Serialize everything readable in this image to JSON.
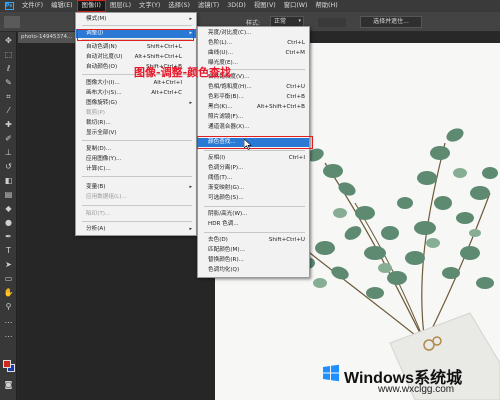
{
  "menubar": {
    "logo": "Ps",
    "items": [
      "文件(F)",
      "编辑(E)",
      "图像(I)",
      "图层(L)",
      "文字(Y)",
      "选择(S)",
      "滤镜(T)",
      "3D(D)",
      "视图(V)",
      "窗口(W)",
      "帮助(H)"
    ]
  },
  "options_bar": {
    "style_label": "样式:",
    "style_value": "正常",
    "select_mask_button": "选择并遮住..."
  },
  "document": {
    "tab_title": "photo-14945374..."
  },
  "image_menu": {
    "items": [
      {
        "label": "模式(M)",
        "shortcut": "",
        "submenu": true,
        "disabled": false
      },
      {
        "label": "调整(J)",
        "shortcut": "",
        "submenu": true,
        "disabled": false,
        "highlighted": true
      },
      {
        "label": "自动色调(N)",
        "shortcut": "Shift+Ctrl+L",
        "submenu": false,
        "disabled": false
      },
      {
        "label": "自动对比度(U)",
        "shortcut": "Alt+Shift+Ctrl+L",
        "submenu": false,
        "disabled": false
      },
      {
        "label": "自动颜色(O)",
        "shortcut": "Shift+Ctrl+B",
        "submenu": false,
        "disabled": false
      },
      {
        "label": "图像大小(I)...",
        "shortcut": "Alt+Ctrl+I",
        "submenu": false,
        "disabled": false
      },
      {
        "label": "画布大小(S)...",
        "shortcut": "Alt+Ctrl+C",
        "submenu": false,
        "disabled": false
      },
      {
        "label": "图像旋转(G)",
        "shortcut": "",
        "submenu": true,
        "disabled": false
      },
      {
        "label": "裁剪(P)",
        "shortcut": "",
        "submenu": false,
        "disabled": true
      },
      {
        "label": "裁切(R)...",
        "shortcut": "",
        "submenu": false,
        "disabled": false
      },
      {
        "label": "显示全部(V)",
        "shortcut": "",
        "submenu": false,
        "disabled": false
      },
      {
        "label": "复制(D)...",
        "shortcut": "",
        "submenu": false,
        "disabled": false
      },
      {
        "label": "应用图像(Y)...",
        "shortcut": "",
        "submenu": false,
        "disabled": false
      },
      {
        "label": "计算(C)...",
        "shortcut": "",
        "submenu": false,
        "disabled": false
      },
      {
        "label": "变量(B)",
        "shortcut": "",
        "submenu": true,
        "disabled": false
      },
      {
        "label": "应用数据组(L)...",
        "shortcut": "",
        "submenu": false,
        "disabled": true
      },
      {
        "label": "陷印(T)...",
        "shortcut": "",
        "submenu": false,
        "disabled": true
      },
      {
        "label": "分析(A)",
        "shortcut": "",
        "submenu": true,
        "disabled": false
      }
    ]
  },
  "adjust_menu": {
    "items": [
      {
        "label": "亮度/对比度(C)...",
        "shortcut": ""
      },
      {
        "label": "色阶(L)...",
        "shortcut": "Ctrl+L"
      },
      {
        "label": "曲线(U)...",
        "shortcut": "Ctrl+M"
      },
      {
        "label": "曝光度(E)...",
        "shortcut": ""
      },
      {
        "label": "自然饱和度(V)...",
        "shortcut": ""
      },
      {
        "label": "色相/饱和度(H)...",
        "shortcut": "Ctrl+U"
      },
      {
        "label": "色彩平衡(B)...",
        "shortcut": "Ctrl+B"
      },
      {
        "label": "黑白(K)...",
        "shortcut": "Alt+Shift+Ctrl+B"
      },
      {
        "label": "照片滤镜(F)...",
        "shortcut": ""
      },
      {
        "label": "通道混合器(X)...",
        "shortcut": ""
      },
      {
        "label": "颜色查找...",
        "shortcut": "",
        "highlighted": true
      },
      {
        "label": "反相(I)",
        "shortcut": "Ctrl+I"
      },
      {
        "label": "色调分离(P)...",
        "shortcut": ""
      },
      {
        "label": "阈值(T)...",
        "shortcut": ""
      },
      {
        "label": "渐变映射(G)...",
        "shortcut": ""
      },
      {
        "label": "可选颜色(S)...",
        "shortcut": ""
      },
      {
        "label": "阴影/高光(W)...",
        "shortcut": ""
      },
      {
        "label": "HDR 色调...",
        "shortcut": ""
      },
      {
        "label": "去色(D)",
        "shortcut": "Shift+Ctrl+U"
      },
      {
        "label": "匹配颜色(M)...",
        "shortcut": ""
      },
      {
        "label": "替换颜色(R)...",
        "shortcut": ""
      },
      {
        "label": "色调均化(Q)",
        "shortcut": ""
      }
    ]
  },
  "annotation": {
    "text": "图像-调整-颜色查找"
  },
  "watermark": {
    "title": "Windows系统城",
    "url": "www.wxclgg.com"
  },
  "colors": {
    "annotation_red": "#e8182a",
    "highlight_blue": "#2a79d4",
    "foreground_swatch": "#d0281e",
    "background_swatch": "#1a3ca8"
  }
}
